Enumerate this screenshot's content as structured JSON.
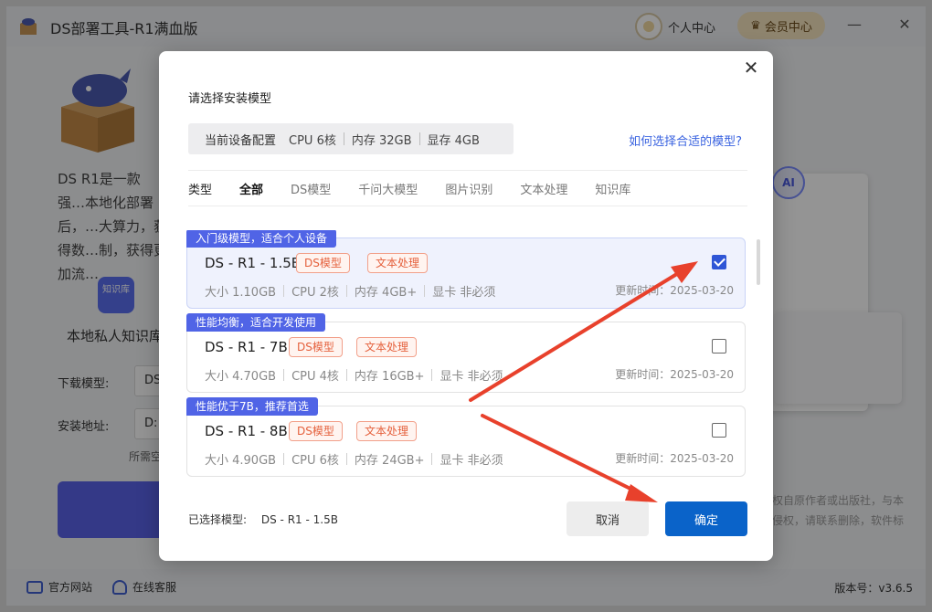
{
  "app": {
    "title": "DS部署工具-R1满血版",
    "user_center": "个人中心",
    "vip_center": "会员中心",
    "minimize": "—",
    "close": "✕",
    "desc": "DS R1是一款强…本地化部署后，…大算力，获得数…制，获得更加流…",
    "kb_icon_text": "知识库",
    "kb_label": "本地私人知识库",
    "download_model_label": "下载模型:",
    "download_model_value": "DS",
    "install_path_label": "安装地址:",
    "install_path_value": "D:",
    "need_space": "所需空",
    "ai_badge": "AI",
    "bg_note_1": "权自原作者或出版社，与本",
    "bg_note_2": "侵权，请联系删除，软件标"
  },
  "footer": {
    "website": "官方网站",
    "support": "在线客服",
    "version": "版本号：v3.6.5"
  },
  "dialog": {
    "title": "请选择安装模型",
    "close": "✕",
    "device": {
      "label": "当前设备配置",
      "cpu": "CPU 6核",
      "memory": "内存 32GB",
      "gpu": "显存 4GB"
    },
    "help_link": "如何选择合适的模型?",
    "tabs": {
      "type_label": "类型",
      "items": [
        "全部",
        "DS模型",
        "千问大模型",
        "图片识别",
        "文本处理",
        "知识库"
      ],
      "active_index": 0
    },
    "models": [
      {
        "tag": "入门级模型，适合个人设备",
        "name": "DS - R1 - 1.5B",
        "pills": [
          "DS模型",
          "文本处理"
        ],
        "size": "大小 1.10GB",
        "cpu": "CPU 2核",
        "memory": "内存 4GB+",
        "gpu": "显卡 非必须",
        "updated": "更新时间：2025-03-20",
        "checked": true
      },
      {
        "tag": "性能均衡，适合开发使用",
        "name": "DS - R1 - 7B",
        "pills": [
          "DS模型",
          "文本处理"
        ],
        "size": "大小 4.70GB",
        "cpu": "CPU 4核",
        "memory": "内存 16GB+",
        "gpu": "显卡 非必须",
        "updated": "更新时间：2025-03-20",
        "checked": false
      },
      {
        "tag": "性能优于7B，推荐首选",
        "name": "DS - R1 - 8B",
        "pills": [
          "DS模型",
          "文本处理"
        ],
        "size": "大小 4.90GB",
        "cpu": "CPU 6核",
        "memory": "内存 24GB+",
        "gpu": "显卡 非必须",
        "updated": "更新时间：2025-03-20",
        "checked": false
      }
    ],
    "selected_label": "已选择模型:",
    "selected_value": "DS - R1 - 1.5B",
    "cancel": "取消",
    "confirm": "确定"
  },
  "colors": {
    "accent": "#0a63c9",
    "tag_bg": "#5064e6",
    "pill": "#e5603c",
    "annotation_arrow": "#e8412c"
  }
}
